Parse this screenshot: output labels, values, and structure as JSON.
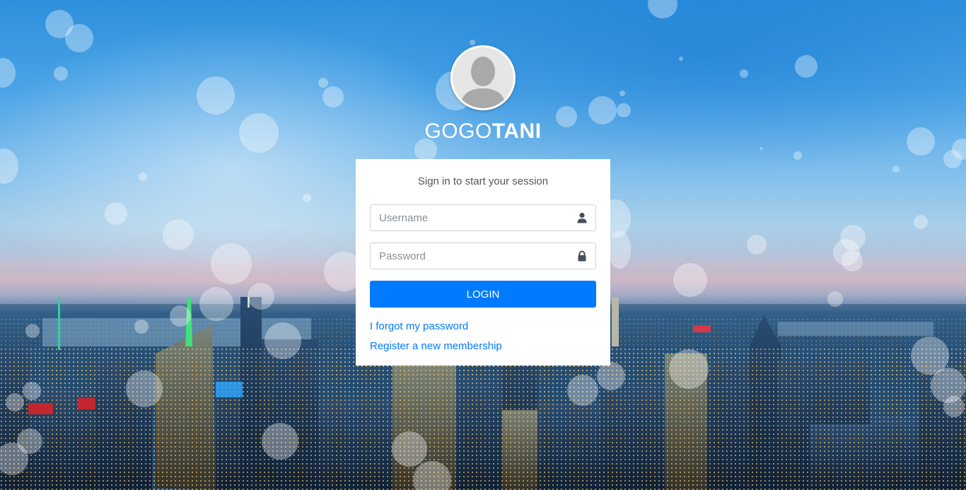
{
  "brand": {
    "logo_light": "GOGO",
    "logo_bold": "TANI"
  },
  "login": {
    "message": "Sign in to start your session",
    "username_placeholder": "Username",
    "password_placeholder": "Password",
    "login_button": "LOGIN",
    "forgot_link": "I forgot my password",
    "register_link": "Register a new membership"
  },
  "icons": {
    "username": "user-icon",
    "password": "lock-icon",
    "avatar": "default-user-avatar"
  },
  "colors": {
    "primary": "#007bff",
    "panel": "#ffffff",
    "sky": "#2d8fdc"
  }
}
